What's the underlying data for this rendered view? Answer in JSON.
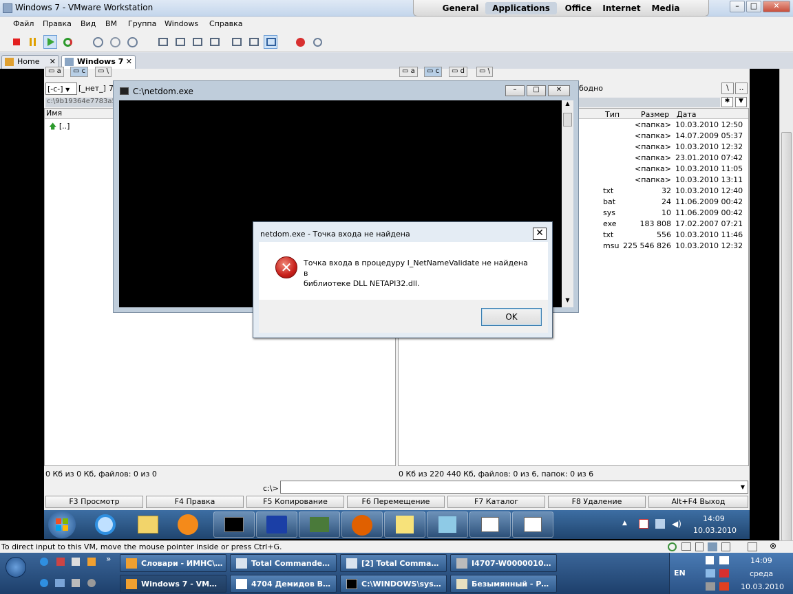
{
  "host": {
    "title": "Windows 7 - VMware Workstation",
    "launch_tabs": [
      "General",
      "Applications",
      "Office",
      "Internet",
      "Media"
    ],
    "selected_tab": "Applications",
    "menu": [
      "Файл",
      "Правка",
      "Вид",
      "ВМ",
      "Группа",
      "Windows",
      "Справка"
    ],
    "tabs": [
      {
        "label": "Home"
      },
      {
        "label": "Windows 7"
      }
    ],
    "status_text": "To direct input to this VM, move the mouse pointer inside or press Ctrl+G."
  },
  "tc": {
    "left_drives": [
      "a",
      "c",
      "\\"
    ],
    "right_drives": [
      "a",
      "c",
      "d",
      "\\"
    ],
    "left_combo": "[-c-]",
    "left_label": "[_нет_]",
    "left_free_fragment": "7",
    "right_free_fragment": "бодно",
    "left_path": "c:\\9b19364e7783a5",
    "left_col_name": "Имя",
    "left_up": "[..]",
    "right_cols": {
      "type": "Тип",
      "size": "Размер",
      "date": "Дата"
    },
    "right_rows": [
      {
        "type": "",
        "size": "<папка>",
        "date": "10.03.2010 12:50"
      },
      {
        "type": "",
        "size": "<папка>",
        "date": "14.07.2009 05:37"
      },
      {
        "type": "",
        "size": "<папка>",
        "date": "10.03.2010 12:32"
      },
      {
        "type": "",
        "size": "<папка>",
        "date": "23.01.2010 07:42"
      },
      {
        "type": "",
        "size": "<папка>",
        "date": "10.03.2010 11:05"
      },
      {
        "type": "",
        "size": "<папка>",
        "date": "10.03.2010 13:11"
      },
      {
        "type": "txt",
        "size": "32",
        "date": "10.03.2010 12:40"
      },
      {
        "type": "bat",
        "size": "24",
        "date": "11.06.2009 00:42"
      },
      {
        "type": "sys",
        "size": "10",
        "date": "11.06.2009 00:42"
      },
      {
        "type": "exe",
        "size": "183 808",
        "date": "17.02.2007 07:21"
      },
      {
        "type": "txt",
        "size": "556",
        "date": "10.03.2010 11:46"
      },
      {
        "type": "msu",
        "size": "225 546 826",
        "date": "10.03.2010 12:32"
      }
    ],
    "left_status": "0 Кб из 0 Кб, файлов: 0 из 0",
    "right_status": "0 Кб из 220 440 Кб, файлов: 0 из 6, папок: 0 из 6",
    "cmd_prompt": "c:\\>",
    "fkeys": [
      "F3 Просмотр",
      "F4 Правка",
      "F5 Копирование",
      "F6 Перемещение",
      "F7 Каталог",
      "F8 Удаление",
      "Alt+F4 Выход"
    ]
  },
  "console": {
    "title": "C:\\netdom.exe"
  },
  "dialog": {
    "title": "netdom.exe - Точка входа не найдена",
    "line1": "Точка входа в процедуру I_NetNameValidate не найдена в",
    "line2": "библиотеке DLL NETAPI32.dll.",
    "ok": "OK"
  },
  "guest_taskbar": {
    "time": "14:09",
    "date": "10.03.2010"
  },
  "host_taskbar": {
    "row1": [
      "Словари - ИМНС\\К...",
      "Total Commander 7....",
      "[2] Total Commande...",
      "I4707-W00000103 - ..."
    ],
    "row2": [
      "Windows 7 - VMwa...",
      "4704 Демидов В.Л. ...",
      "C:\\WINDOWS\\syste...",
      "Безымянный - Pain..."
    ],
    "lang": "EN",
    "time": "14:09",
    "day": "среда",
    "date": "10.03.2010"
  }
}
